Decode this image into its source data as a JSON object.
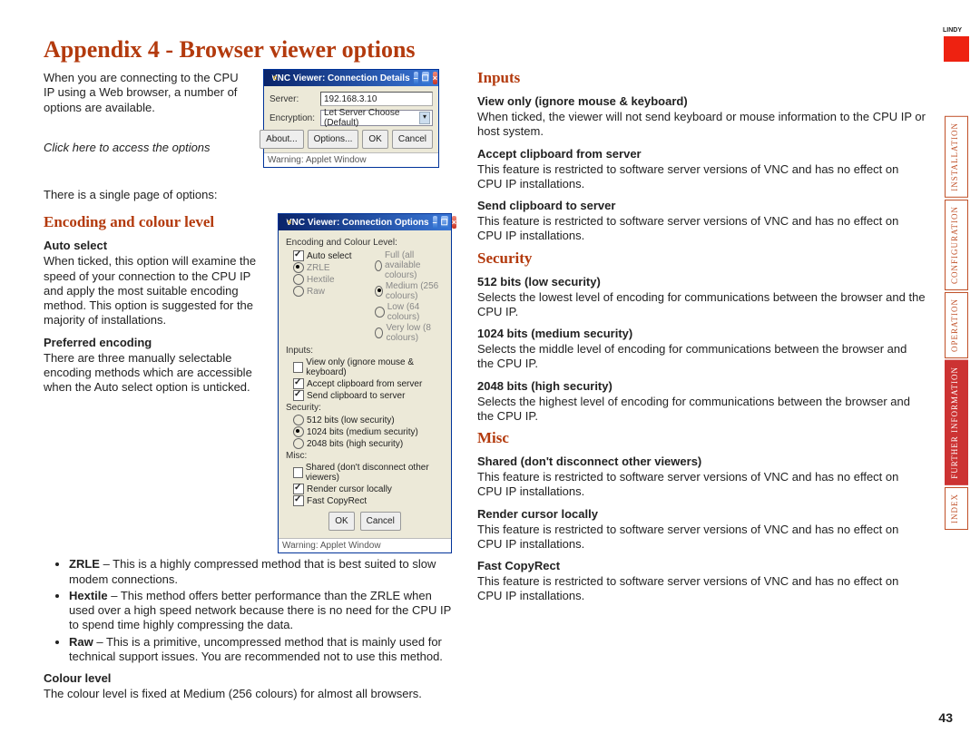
{
  "title": "Appendix 4 - Browser viewer options",
  "intro1": "When you are connecting to the CPU IP using a Web browser, a number of options are available.",
  "caption_options": "Click here to access the options",
  "single_page": "There is a single page of options:",
  "sec_encoding": "Encoding and colour level",
  "auto_select_h": "Auto select",
  "auto_select_p": "When ticked, this option will examine the speed of your connection to the CPU IP and apply the most suitable encoding method. This option is suggested for the majority of installations.",
  "pref_enc_h": "Preferred encoding",
  "pref_enc_p": "There are three manually selectable encoding methods which are accessible when the Auto select option is unticked.",
  "li_zrle": " – This is a highly compressed method that is best suited to slow modem connections.",
  "li_zrle_b": "ZRLE",
  "li_hextile_b": "Hextile",
  "li_hextile": " – This method offers better performance than the ZRLE when used over a high speed network because there is no need for the CPU IP to spend time highly compressing the data.",
  "li_raw_b": "Raw",
  "li_raw": " – This is a primitive, uncompressed method that is mainly used for technical support issues. You are recommended not to use this method.",
  "colourlevel_h": "Colour level",
  "colourlevel_p": "The colour level is fixed at Medium (256 colours) for almost all browsers.",
  "sec_inputs": "Inputs",
  "viewonly_h": "View only (ignore mouse & keyboard)",
  "viewonly_p": "When ticked, the viewer will not send keyboard or mouse information to the CPU IP or host system.",
  "accept_h": "Accept clipboard from server",
  "restricted_p": "This feature is restricted to software server versions of VNC and has no effect on CPU IP installations.",
  "send_h": "Send clipboard to server",
  "sec_security": "Security",
  "sec512_h": "512 bits (low security)",
  "sec512_p": "Selects the lowest level of encoding for communications between the browser and the CPU IP.",
  "sec1024_h": "1024 bits (medium security)",
  "sec1024_p": "Selects the middle level of encoding for communications between the browser and the CPU IP.",
  "sec2048_h": "2048 bits (high security)",
  "sec2048_p": "Selects the highest level of encoding for communications between the browser and the CPU IP.",
  "sec_misc": "Misc",
  "shared_h": "Shared (don't disconnect other viewers)",
  "render_h": "Render cursor locally",
  "fast_h": "Fast CopyRect",
  "logo_txt": "LINDY",
  "nav0": "Installation",
  "nav1": "Configuration",
  "nav2": "Operation",
  "nav3": "Further information",
  "nav4": "Index",
  "pgnum": "43",
  "vnc1_title": "VNC Viewer: Connection Details",
  "vnc1_server_lbl": "Server:",
  "vnc1_server_val": "192.168.3.10",
  "vnc1_enc_lbl": "Encryption:",
  "vnc1_enc_val": "Let Server Choose (Default)",
  "vnc1_btn_about": "About...",
  "vnc1_btn_options": "Options...",
  "vnc1_btn_ok": "OK",
  "vnc1_btn_cancel": "Cancel",
  "vnc_status": "Warning: Applet Window",
  "vnc2_title": "VNC Viewer: Connection Options",
  "grp_enc": "Encoding and Colour Level:",
  "opt_auto": "Auto select",
  "opt_full": "Full (all available colours)",
  "opt_zrle": "ZRLE",
  "opt_med": "Medium (256 colours)",
  "opt_hextile": "Hextile",
  "opt_low": "Low (64 colours)",
  "opt_raw": "Raw",
  "opt_vlow": "Very low (8 colours)",
  "grp_inputs": "Inputs:",
  "opt_viewonly": "View only (ignore mouse & keyboard)",
  "opt_accept": "Accept clipboard from server",
  "opt_send": "Send clipboard to server",
  "grp_sec": "Security:",
  "opt_512": "512 bits (low security)",
  "opt_1024": "1024 bits (medium security)",
  "opt_2048": "2048 bits (high security)",
  "grp_misc": "Misc:",
  "opt_shared": "Shared (don't disconnect other viewers)",
  "opt_render": "Render cursor locally",
  "opt_copyrect": "Fast CopyRect",
  "btn_ok": "OK",
  "btn_cancel": "Cancel"
}
